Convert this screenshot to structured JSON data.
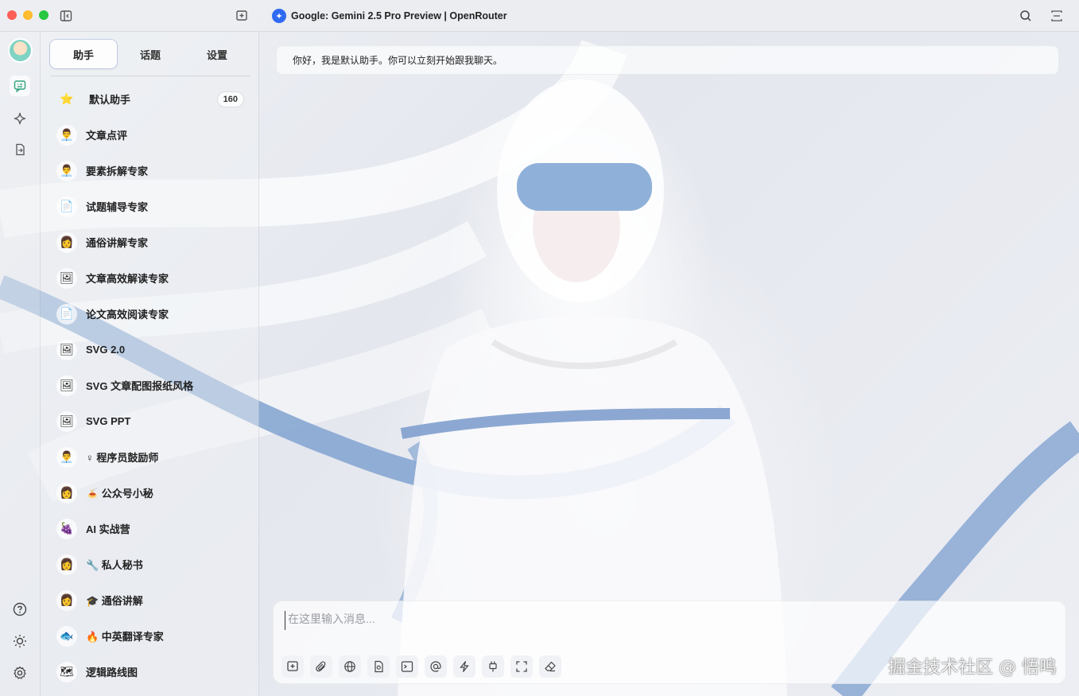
{
  "window": {
    "model_title": "Google: Gemini 2.5 Pro Preview | OpenRouter"
  },
  "rail": {
    "top_icons": [
      "chat-icon",
      "sparkle-icon",
      "file-swap-icon"
    ],
    "bottom_icons": [
      "help-icon",
      "sun-icon",
      "gear-icon"
    ]
  },
  "sidebar": {
    "tabs": [
      {
        "label": "助手"
      },
      {
        "label": "话题"
      },
      {
        "label": "设置"
      }
    ],
    "assistants": [
      {
        "emoji": "⭐",
        "name": "默认助手",
        "count": "160"
      },
      {
        "emoji": "👨‍💼",
        "name": "文章点评"
      },
      {
        "emoji": "👨‍💼",
        "name": "要素拆解专家"
      },
      {
        "emoji": "📄",
        "name": "试题辅导专家"
      },
      {
        "emoji": "👩",
        "name": "通俗讲解专家"
      },
      {
        "emoji": "🖼",
        "name": "文章高效解读专家"
      },
      {
        "emoji": "📄",
        "name": "论文高效阅读专家"
      },
      {
        "emoji": "🖼",
        "name": "SVG 2.0"
      },
      {
        "emoji": "🖼",
        "name": "SVG 文章配图报纸风格"
      },
      {
        "emoji": "🖼",
        "name": "SVG PPT"
      },
      {
        "emoji": "👨‍💼",
        "name": "♀ 程序员鼓励师"
      },
      {
        "emoji": "👩",
        "name": "🍝 公众号小秘"
      },
      {
        "emoji": "🍇",
        "name": "AI 实战营"
      },
      {
        "emoji": "👩",
        "name": "🔧 私人秘书"
      },
      {
        "emoji": "👩",
        "name": "🎓 通俗讲解"
      },
      {
        "emoji": "🐟",
        "name": "🔥 中英翻译专家"
      },
      {
        "emoji": "🗺",
        "name": "逻辑路线图"
      }
    ]
  },
  "chat": {
    "greeting": "你好，我是默认助手。你可以立刻开始跟我聊天。",
    "input_placeholder": "在这里输入消息...",
    "tools": [
      "new-topic-icon",
      "attachment-icon",
      "web-search-icon",
      "knowledge-file-icon",
      "terminal-icon",
      "mention-icon",
      "quick-phrase-icon",
      "plugin-icon",
      "fullscreen-icon",
      "eraser-icon"
    ]
  },
  "watermark": "掘金技术社区 @ 悟鸣",
  "colors": {
    "accent_green": "#2ea37a",
    "model_logo_blue": "#2f6bf2",
    "ribbon_blue": "#86a6d2"
  }
}
